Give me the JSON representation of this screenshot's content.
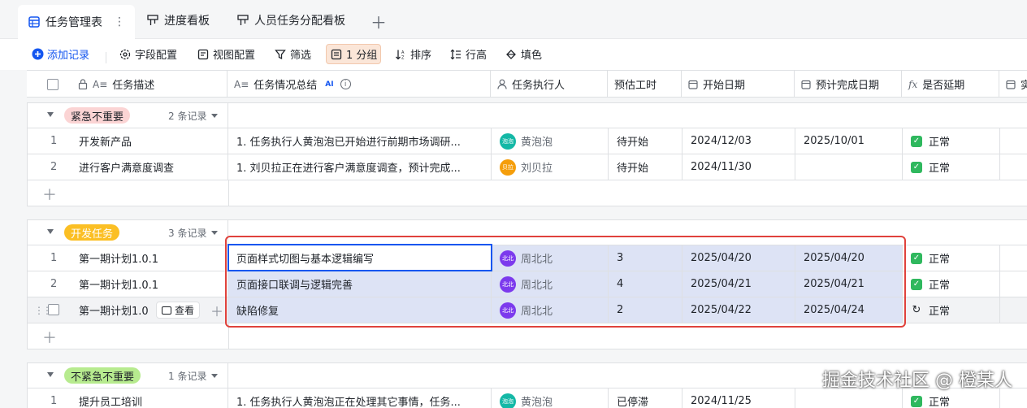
{
  "tabs": [
    {
      "label": "任务管理表",
      "icon": "table-icon",
      "active": true
    },
    {
      "label": "进度看板",
      "icon": "kanban-icon",
      "active": false
    },
    {
      "label": "人员任务分配看板",
      "icon": "kanban-icon",
      "active": false
    }
  ],
  "toolbar": {
    "add": "添加记录",
    "fields": "字段配置",
    "view": "视图配置",
    "filter": "筛选",
    "group": "1 分组",
    "sort": "排序",
    "row_height": "行高",
    "fill": "填色"
  },
  "columns": {
    "desc": "任务描述",
    "summary": "任务情况总结",
    "ai": "AI",
    "assignee": "任务执行人",
    "estimate": "预估工时",
    "start": "开始日期",
    "due": "预计完成日期",
    "delayed": "是否延期",
    "next": "实"
  },
  "groups": [
    {
      "name": "紧急不重要",
      "count": "2 条记录",
      "rows": [
        {
          "num": "1",
          "desc": "开发新产品",
          "summary": "1. 任务执行人黄泡泡已开始进行前期市场调研...",
          "assignee": "黄泡泡",
          "avatar": "泡泡",
          "estimate": "待开始",
          "start": "2024/12/03",
          "due": "2025/10/01",
          "delayed": "正常"
        },
        {
          "num": "2",
          "desc": "进行客户满意度调查",
          "summary": "1. 刘贝拉正在进行客户满意度调查，预计完成...",
          "assignee": "刘贝拉",
          "avatar": "贝拉",
          "estimate": "待开始",
          "start": "2024/11/30",
          "due": "",
          "delayed": "正常"
        }
      ]
    },
    {
      "name": "开发任务",
      "count": "3 条记录",
      "rows": [
        {
          "num": "1",
          "desc": "第一期计划1.0.1",
          "summary": "页面样式切图与基本逻辑编写",
          "assignee": "周北北",
          "avatar": "北北",
          "estimate": "3",
          "start": "2025/04/20",
          "due": "2025/04/20",
          "delayed": "正常"
        },
        {
          "num": "2",
          "desc": "第一期计划1.0.1",
          "summary": "页面接口联调与逻辑完善",
          "assignee": "周北北",
          "avatar": "北北",
          "estimate": "4",
          "start": "2025/04/21",
          "due": "2025/04/21",
          "delayed": "正常"
        },
        {
          "num": "",
          "desc": "第一期计划1.0",
          "summary": "缺陷修复",
          "assignee": "周北北",
          "avatar": "北北",
          "estimate": "2",
          "start": "2025/04/22",
          "due": "2025/04/24",
          "delayed": "正常",
          "view_label": "查看"
        }
      ]
    },
    {
      "name": "不紧急不重要",
      "count": "1 条记录",
      "rows": [
        {
          "num": "1",
          "desc": "提升员工培训",
          "summary": "1. 任务执行人黄泡泡正在处理其它事情，任务...",
          "assignee": "黄泡泡",
          "avatar": "泡泡",
          "estimate": "已停滞",
          "start": "2024/11/25",
          "due": "",
          "delayed": "正常"
        }
      ]
    }
  ],
  "watermark": "掘金技术社区 @ 橙某人",
  "colors": {
    "accent": "#1456f0",
    "group1": "#fbd4d4",
    "group2": "#fbbf24",
    "group3": "#b7eb8f",
    "avatar_huang": "#14b8a6",
    "avatar_liu": "#f59e0b",
    "avatar_zhou": "#7c3aed"
  }
}
